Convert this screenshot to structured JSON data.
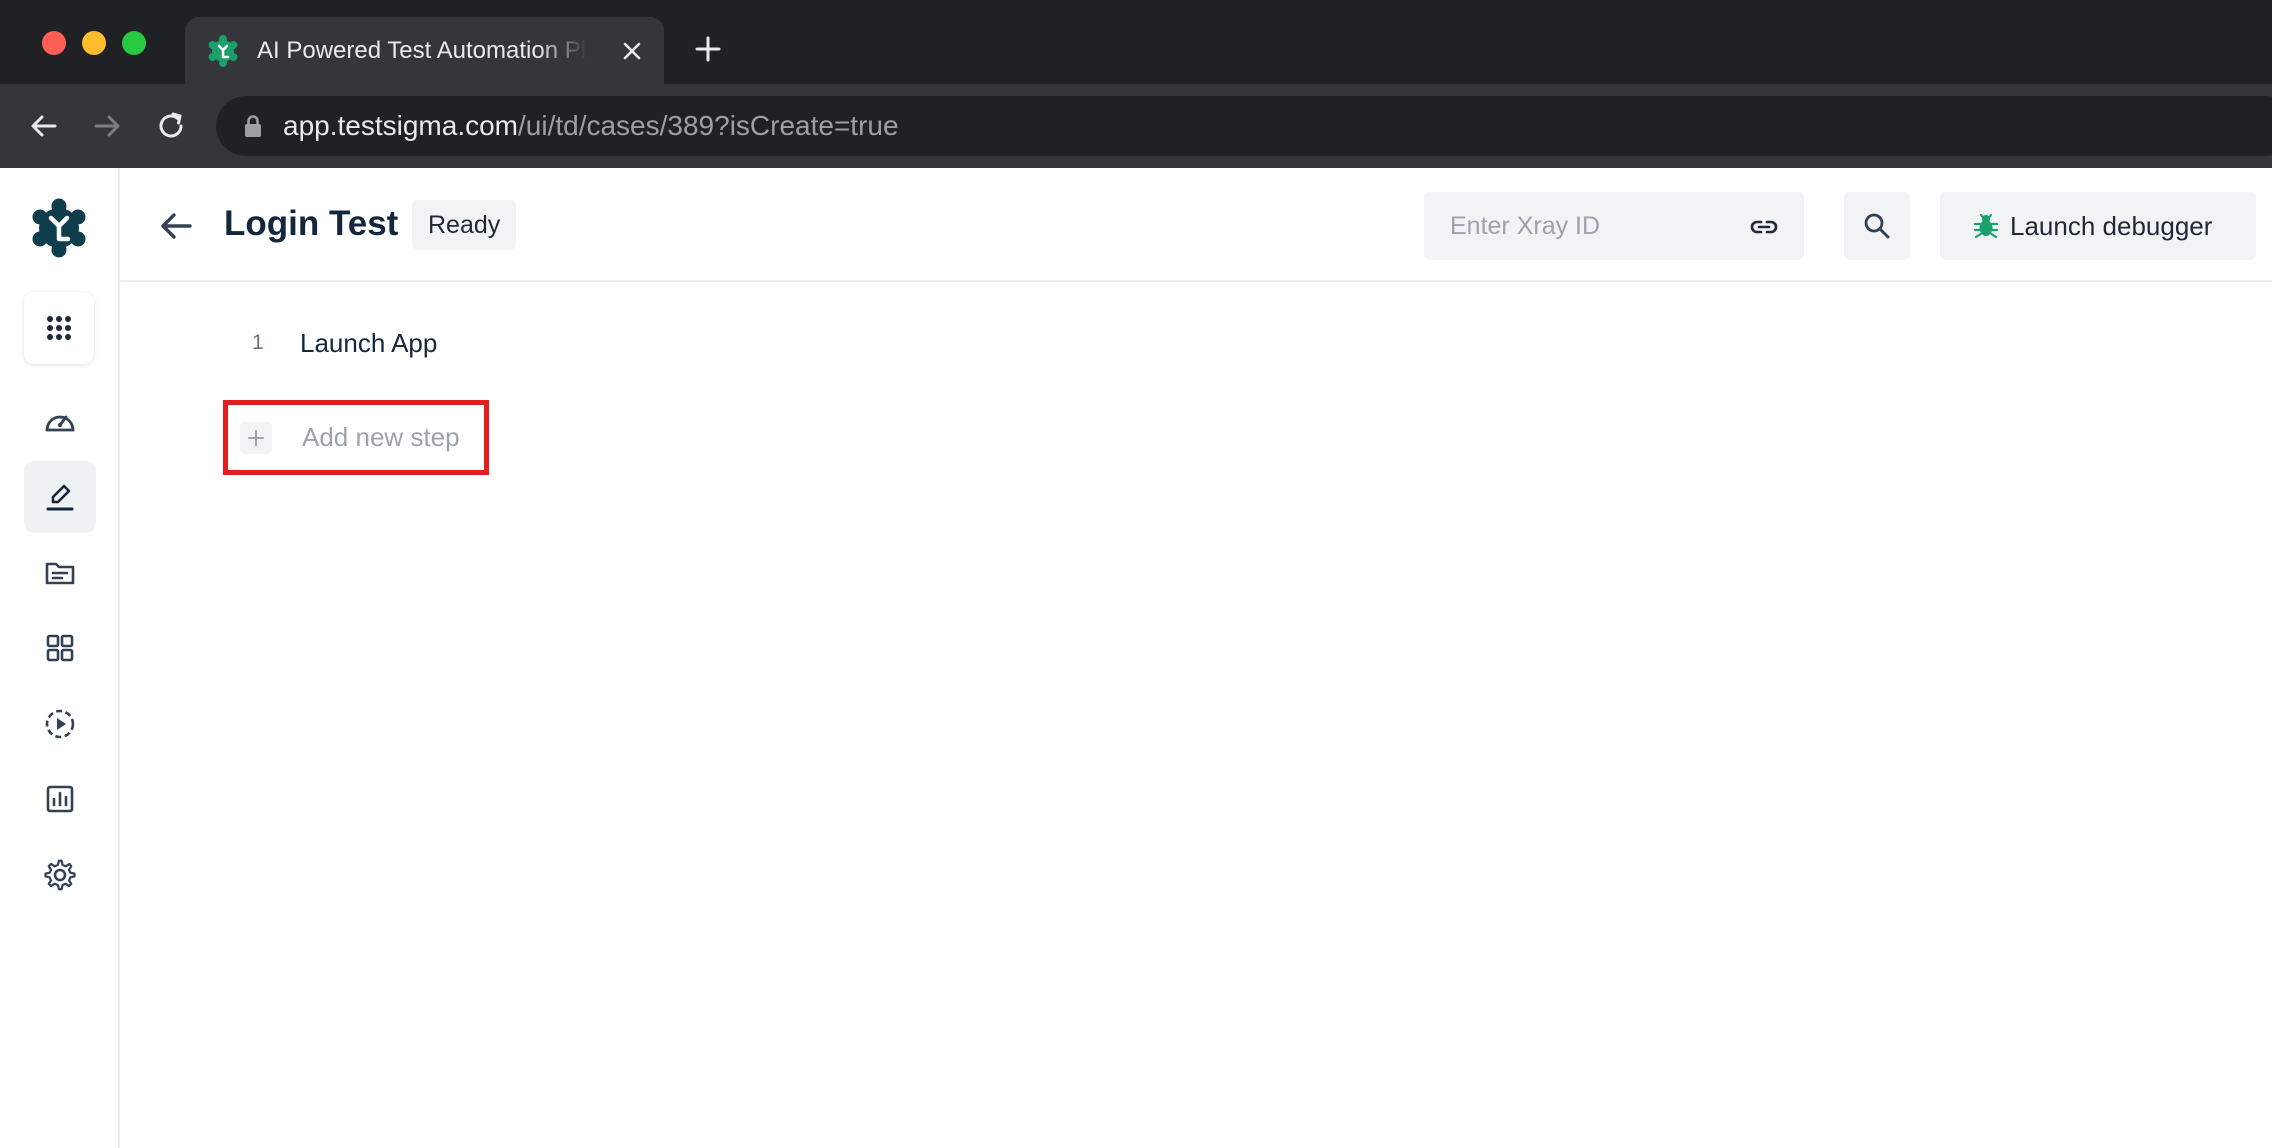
{
  "browser": {
    "tab_title": "AI Powered Test Automation Platform",
    "url_host": "app.testsigma.com",
    "url_path": "/ui/td/cases/389?isCreate=true"
  },
  "header": {
    "title": "Login Test",
    "status": "Ready",
    "xray_placeholder": "Enter Xray ID",
    "debugger_label": "Launch debugger"
  },
  "steps": [
    {
      "number": "1",
      "label": "Launch App"
    }
  ],
  "add_step_label": "Add new step",
  "icons": {
    "sidebar": [
      "apps-grid-icon",
      "dashboard-gauge-icon",
      "edit-pen-icon",
      "folder-icon",
      "grid-icon",
      "run-play-icon",
      "reports-chart-icon",
      "settings-gear-icon"
    ]
  },
  "colors": {
    "brand": "#0f3d4c",
    "accent_green": "#1aa068",
    "highlight_red": "#e41e1e"
  }
}
